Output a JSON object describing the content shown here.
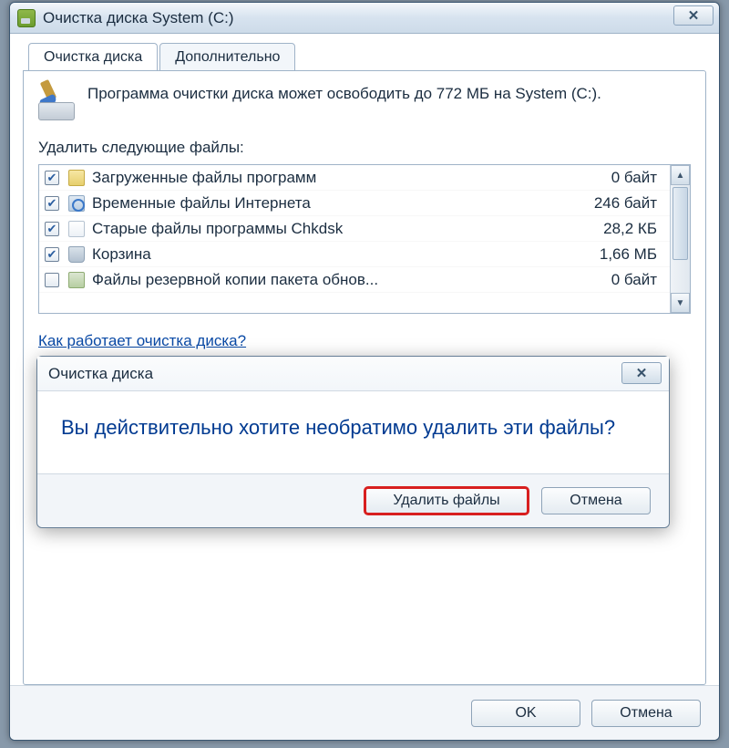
{
  "window": {
    "title": "Очистка диска System (C:)",
    "close_glyph": "✕"
  },
  "tabs": {
    "cleanup": "Очистка диска",
    "more": "Дополнительно"
  },
  "intro": "Программа очистки диска может освободить до 772 МБ на System (C:).",
  "list_label": "Удалить следующие файлы:",
  "files": [
    {
      "checked": true,
      "icon": "ic-folder",
      "name": "Загруженные файлы программ",
      "size": "0 байт"
    },
    {
      "checked": true,
      "icon": "ic-ie",
      "name": "Временные файлы Интернета",
      "size": "246 байт"
    },
    {
      "checked": true,
      "icon": "ic-file",
      "name": "Старые файлы программы Chkdsk",
      "size": "28,2 КБ"
    },
    {
      "checked": true,
      "icon": "ic-bin",
      "name": "Корзина",
      "size": "1,66 МБ"
    },
    {
      "checked": false,
      "icon": "ic-pkg",
      "name": "Файлы резервной копии пакета обнов...",
      "size": "0 байт"
    }
  ],
  "help_link": "Как работает очистка диска?",
  "footer": {
    "ok": "OK",
    "cancel": "Отмена"
  },
  "confirm": {
    "title": "Очистка диска",
    "message": "Вы действительно хотите необратимо удалить эти файлы?",
    "delete": "Удалить файлы",
    "cancel": "Отмена",
    "close_glyph": "✕"
  },
  "scroll": {
    "up": "▲",
    "down": "▼"
  }
}
